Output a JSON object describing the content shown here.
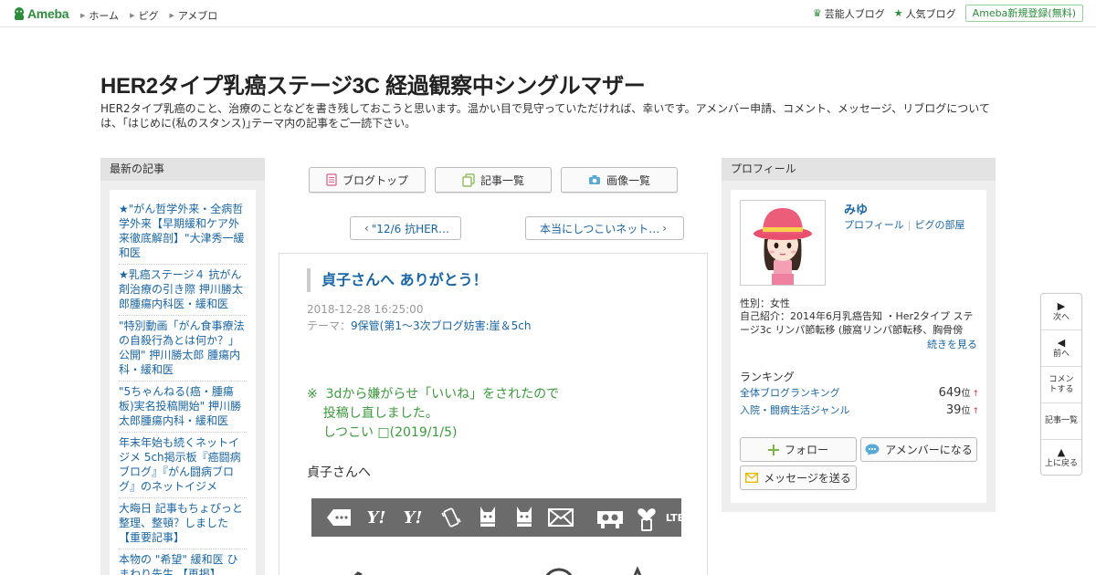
{
  "topbar": {
    "logo_text": "Ameba",
    "nav": [
      "ホーム",
      "ピグ",
      "アメブロ"
    ],
    "right_links": [
      "芸能人ブログ",
      "人気ブログ"
    ],
    "register_label": "Ameba新規登録(無料)"
  },
  "header": {
    "title": "HER2タイプ乳癌ステージ3C 経過観察中シングルマザー",
    "description": "HER2タイプ乳癌のこと、治療のことなどを書き残しておこうと思います。温かい目で見守っていただければ、幸いです。アメンバー申請、コメント、メッセージ、リブログについては、｢はじめに(私のスタンス)｣テーマ内の記事をご一読下さい。"
  },
  "sidebar": {
    "heading": "最新の記事",
    "articles": [
      "★\"がん哲学外来・全病哲学外来【早期緩和ケア外来徹底解剖】\"大津秀一緩和医",
      "★乳癌ステージ４ 抗がん剤治療の引き際 押川勝太郎腫瘍内科医・緩和医",
      "\"特別動画「がん食事療法の自殺行為とは何か？」公開\" 押川勝太郎 腫瘍内科・緩和医",
      "\"5ちゃんねる(癌・腫瘍板)実名投稿開始\" 押川勝太郎腫瘍内科・緩和医",
      "年末年始も続くネットイジメ 5ch掲示板『癌闘病ブログ』『がん闘病ブログ』のネットイジメ",
      "大晦日 記事もちょぴっと整理、整頓？しました【重要記事】",
      "本物の \"希望\" 緩和医 ひまわり先生 【再掲】"
    ]
  },
  "toolbar": {
    "blog_top": "ブログトップ",
    "article_list": "記事一覧",
    "image_list": "画像一覧"
  },
  "pager": {
    "prev": "\"12/6 抗HER…",
    "next": "本当にしつこいネット…"
  },
  "entry": {
    "title": "貞子さんへ ありがとう！",
    "date": "2018-12-28 16:25:00",
    "theme_label": "テーマ：",
    "theme": "9保管(第1～3次ブログ妨害:崖＆5ch",
    "note_lines": [
      "※  3dから嫌がらせ「いいね」をされたので",
      "    投稿し直しました。",
      "    しつこい □(2019/1/5)"
    ],
    "greeting": "貞子さんへ"
  },
  "profile": {
    "heading": "プロフィール",
    "name": "みゆ",
    "profile_link": "プロフィール",
    "pig_link": "ピグの部屋",
    "gender": "性別：女性",
    "intro": "自己紹介：2014年6月乳癌告知 ・Her2タイプ ステージ3c リンパ節転移 (腋窩リンパ節転移、胸骨傍リ...",
    "more": "続きを見る",
    "ranking_heading": "ランキング",
    "rankings": [
      {
        "label": "全体ブログランキング",
        "value": "649",
        "unit": "位",
        "trend": "↑"
      },
      {
        "label": "入院・闘病生活ジャンル",
        "value": "39",
        "unit": "位",
        "trend": "↑"
      }
    ],
    "follow": "フォロー",
    "amember": "アメンバーになる",
    "message": "メッセージを送る"
  },
  "float_nav": {
    "next": "次へ",
    "prev": "前へ",
    "comment": "コメントする",
    "list": "記事一覧",
    "top": "上に戻る"
  },
  "colors": {
    "brand_green": "#2d8c3c",
    "link_blue": "#1965a5",
    "note_green": "#3c9a3c",
    "strip_gray": "#6b6b6b"
  }
}
